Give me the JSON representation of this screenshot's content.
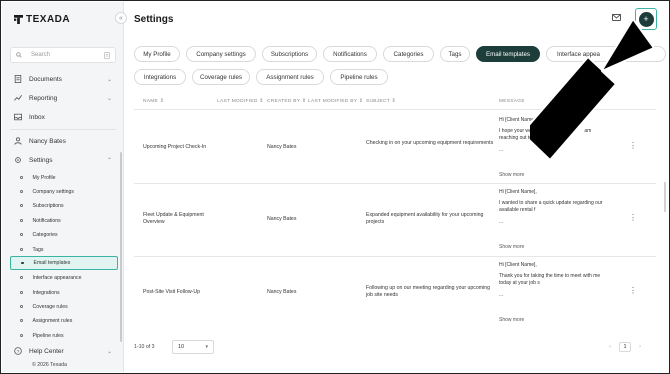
{
  "app": {
    "brand": "TEXADA",
    "copyright": "© 2026 Texada"
  },
  "sidebar": {
    "search_placeholder": "Search",
    "nav": [
      {
        "label": "Documents"
      },
      {
        "label": "Reporting"
      },
      {
        "label": "Inbox"
      }
    ],
    "user": "Nancy Bates",
    "settings": {
      "label": "Settings",
      "items": [
        {
          "label": "My Profile"
        },
        {
          "label": "Company settings"
        },
        {
          "label": "Subscriptions"
        },
        {
          "label": "Notifications"
        },
        {
          "label": "Categories"
        },
        {
          "label": "Tags"
        },
        {
          "label": "Email templates",
          "active": true
        },
        {
          "label": "Interface appearance"
        },
        {
          "label": "Integrations"
        },
        {
          "label": "Coverage rules"
        },
        {
          "label": "Assignment rules"
        },
        {
          "label": "Pipeline rules"
        }
      ]
    },
    "help": "Help Center"
  },
  "header": {
    "title": "Settings",
    "add_button": "+"
  },
  "tabs": [
    {
      "label": "My Profile"
    },
    {
      "label": "Company settings"
    },
    {
      "label": "Subscriptions"
    },
    {
      "label": "Notifications"
    },
    {
      "label": "Categories"
    },
    {
      "label": "Tags"
    },
    {
      "label": "Email templates",
      "active": true
    },
    {
      "label": "Interface appea"
    },
    {
      "label": "Integrations"
    },
    {
      "label": "Coverage rules"
    },
    {
      "label": "Assignment rules"
    },
    {
      "label": "Pipeline rules"
    }
  ],
  "table": {
    "columns": [
      "NAME",
      "LAST MODIFIED",
      "CREATED BY",
      "LAST MODIFIED BY",
      "SUBJECT",
      "MESSAGE"
    ],
    "show_more": "Show more",
    "rows": [
      {
        "name": "Upcoming Project Check-In",
        "created_by": "Nancy Bates",
        "subject": "Checking in on your upcoming equipment requirements",
        "message": [
          "Hi [Client Name],",
          "I hope your week is off",
          "am",
          "reaching out to se",
          "..."
        ]
      },
      {
        "name": "Fleet Update & Equipment Overview",
        "created_by": "Nancy Bates",
        "subject": "Expanded equipment availability for your upcoming projects",
        "message": [
          "Hi [Client Name],",
          "I wanted to share a quick update regarding our",
          "available rental f",
          "..."
        ]
      },
      {
        "name": "Post-Site Visit Follow-Up",
        "created_by": "Nancy Bates",
        "subject": "Following up on our meeting regarding your upcoming job site needs",
        "message": [
          "Hi [Client Name],",
          "Thank you for taking the time to meet with me",
          "today at your job s",
          "..."
        ]
      }
    ]
  },
  "pagination": {
    "range": "1-10 of 3",
    "page_size": "10",
    "current_page": "1"
  },
  "colors": {
    "accent": "#1c3d3a",
    "highlight": "#3bb5a2"
  },
  "icons": {
    "collapse": "chevron-left-icon",
    "search": "search-icon",
    "mail": "mail-icon",
    "kebab": "more-vertical-icon"
  }
}
